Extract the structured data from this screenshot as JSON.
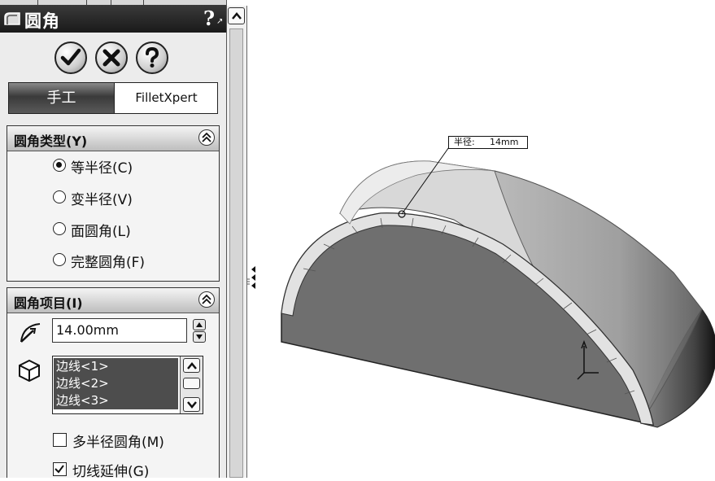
{
  "feature_panel": {
    "title": "圆角",
    "help_glyph": "?",
    "ok_icon": "checkmark-icon",
    "cancel_icon": "x-icon",
    "help_icon": "question-icon"
  },
  "mode_tabs": {
    "manual_label": "手工",
    "expert_label": "FilletXpert",
    "selected": "manual"
  },
  "fillet_type": {
    "header": "圆角类型(Y)",
    "options": [
      {
        "label": "等半径(C)",
        "selected": true
      },
      {
        "label": "变半径(V)",
        "selected": false
      },
      {
        "label": "面圆角(L)",
        "selected": false
      },
      {
        "label": "完整圆角(F)",
        "selected": false
      }
    ]
  },
  "fillet_items": {
    "header": "圆角项目(I)",
    "radius_value": "14.00mm",
    "edges": [
      "边线<1>",
      "边线<2>",
      "边线<3>"
    ],
    "options": [
      {
        "label": "多半径圆角(M)",
        "checked": false
      },
      {
        "label": "切线延伸(G)",
        "checked": true
      }
    ]
  },
  "viewport": {
    "callout_label": "半径:",
    "callout_value": "14mm"
  },
  "colors": {
    "panel_bg": "#ececec",
    "title_bg": "#222222",
    "list_selected": "#4d4d4d",
    "model_face": "#7a7a7a"
  }
}
